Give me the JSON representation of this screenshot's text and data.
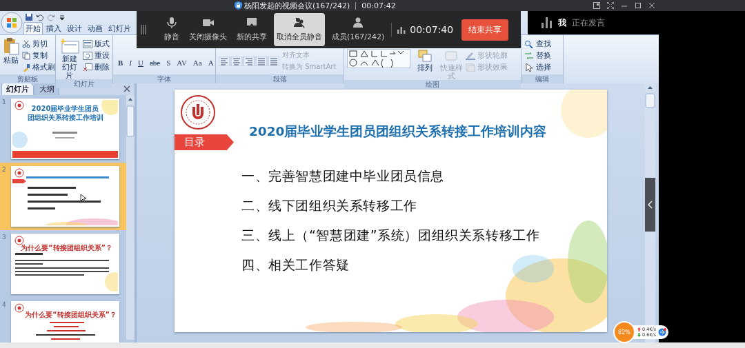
{
  "meeting": {
    "title": "杨阳发起的视频会议(167/242)",
    "elapsed": "00:07:42"
  },
  "meeting_toolbar": {
    "buttons": [
      {
        "label": "静音",
        "kind": "mic",
        "selected": false
      },
      {
        "label": "关闭摄像头",
        "kind": "camera",
        "selected": false
      },
      {
        "label": "新的共享",
        "kind": "share",
        "selected": false
      },
      {
        "label": "取消全员静音",
        "kind": "muteall",
        "selected": true
      },
      {
        "label": "成员(167/242)",
        "kind": "members",
        "selected": false
      }
    ],
    "timer": "00:07:40",
    "end_button": "结束共享"
  },
  "speaker": {
    "name": "我",
    "status": "正在发言"
  },
  "ribbon": {
    "tabs": [
      {
        "label": "开始",
        "selected": true
      },
      {
        "label": "插入",
        "selected": false
      },
      {
        "label": "设计",
        "selected": false
      },
      {
        "label": "动画",
        "selected": false
      },
      {
        "label": "幻灯片",
        "selected": false
      }
    ],
    "groups": [
      {
        "label": "剪贴板",
        "kind": "standard",
        "items": [
          {
            "label": "粘贴",
            "kind": "large",
            "disabled": false
          },
          {
            "label": "剪切",
            "kind": "small",
            "disabled": false
          },
          {
            "label": "复制",
            "kind": "small",
            "disabled": false
          },
          {
            "label": "格式刷",
            "kind": "small",
            "disabled": false
          }
        ]
      },
      {
        "label": "幻灯片",
        "kind": "standard",
        "items": [
          {
            "label": "新建幻灯片",
            "kind": "large",
            "disabled": false
          },
          {
            "label": "版式",
            "kind": "small",
            "disabled": false
          },
          {
            "label": "重设",
            "kind": "small",
            "disabled": false
          },
          {
            "label": "删除",
            "kind": "small",
            "disabled": false
          }
        ]
      },
      {
        "label": "字体",
        "kind": "font",
        "items": [
          {
            "label": "B",
            "kind": "glyph"
          },
          {
            "label": "I",
            "kind": "glyph"
          },
          {
            "label": "U",
            "kind": "glyph"
          },
          {
            "label": "abe",
            "kind": "glyph"
          },
          {
            "label": "S",
            "kind": "glyph"
          },
          {
            "label": "AV",
            "kind": "glyph"
          },
          {
            "label": "Aa",
            "kind": "glyph"
          },
          {
            "label": "A",
            "kind": "glyph"
          }
        ]
      },
      {
        "label": "段落",
        "kind": "paragraph",
        "items": [
          {
            "label": "对齐文本",
            "kind": "small",
            "disabled": true
          },
          {
            "label": "转换为 SmartArt",
            "kind": "small",
            "disabled": true
          }
        ]
      },
      {
        "label": "绘图",
        "kind": "drawing",
        "items": [
          {
            "label": "排列",
            "kind": "large",
            "disabled": false
          },
          {
            "label": "快速样式",
            "kind": "large",
            "disabled": true
          },
          {
            "label": "形状轮廓",
            "kind": "small",
            "disabled": true
          },
          {
            "label": "形状效果",
            "kind": "small",
            "disabled": true
          }
        ]
      },
      {
        "label": "编辑",
        "kind": "standard",
        "items": [
          {
            "label": "查找",
            "kind": "small",
            "disabled": false
          },
          {
            "label": "替换",
            "kind": "small",
            "disabled": false
          },
          {
            "label": "选择",
            "kind": "small",
            "disabled": false
          }
        ]
      }
    ]
  },
  "slide_pane": {
    "tabs": [
      {
        "label": "幻灯片",
        "selected": true
      },
      {
        "label": "大纲",
        "selected": false
      }
    ],
    "thumbnails": [
      {
        "number": "1",
        "selected": false,
        "kind": "title",
        "title_lines": [
          "2020届毕业学生团员",
          "团组织关系转接工作培训"
        ]
      },
      {
        "number": "2",
        "selected": true,
        "kind": "agenda"
      },
      {
        "number": "3",
        "selected": false,
        "kind": "text",
        "title": "为什么要“转接团组织关系”？"
      },
      {
        "number": "4",
        "selected": false,
        "kind": "list",
        "title": "为什么要“转接团组织关系”？"
      }
    ]
  },
  "slide": {
    "title": "2020届毕业学生团员团组织关系转接工作培训内容",
    "tag": "目录",
    "items": [
      "一、完善智慧团建中毕业团员信息",
      "二、线下团组织关系转移工作",
      "三、线上（“智慧团建”系统）团组织关系转移工作",
      "四、相关工作答疑"
    ]
  },
  "net_widget": {
    "percent": "82%",
    "upload": "0.4K/s",
    "download": "0.6K/s"
  }
}
